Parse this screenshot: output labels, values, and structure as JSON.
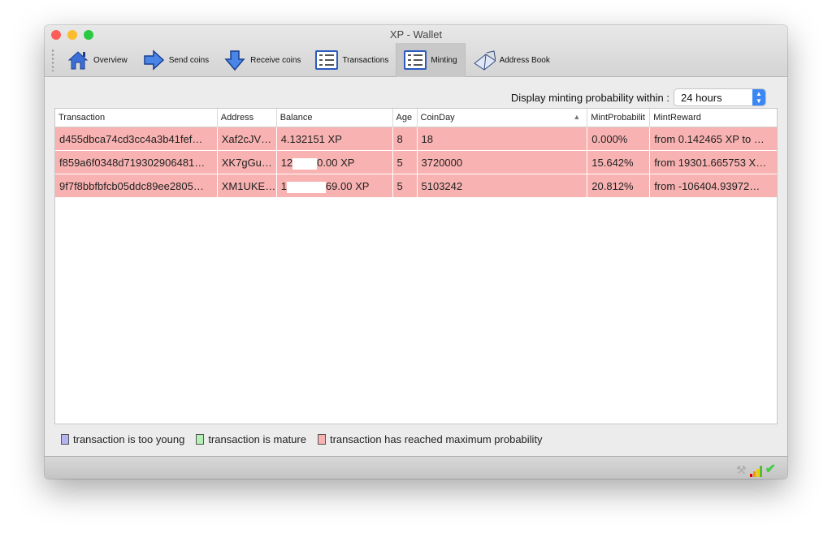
{
  "window": {
    "title": "XP - Wallet"
  },
  "toolbar": {
    "items": [
      {
        "label": "Overview",
        "icon": "home-icon"
      },
      {
        "label": "Send coins",
        "icon": "arrow-right-icon"
      },
      {
        "label": "Receive coins",
        "icon": "arrow-down-icon"
      },
      {
        "label": "Transactions",
        "icon": "list-icon"
      },
      {
        "label": "Minting",
        "icon": "list-icon",
        "active": true
      },
      {
        "label": "Address Book",
        "icon": "book-icon"
      }
    ]
  },
  "minting": {
    "prob_label": "Display minting probability within :",
    "prob_value": "24 hours"
  },
  "table": {
    "headers": [
      "Transaction",
      "Address",
      "Balance",
      "Age",
      "CoinDay",
      "MintProbabilit",
      "MintReward"
    ],
    "sort": {
      "column": "CoinDay",
      "direction": "ascending"
    },
    "rows": [
      {
        "tx": "d455dbca74cd3cc4a3b41fef…",
        "address": "Xaf2cJV…",
        "bal_a": "4.132151 XP",
        "bal_b": "",
        "age": "8",
        "coinday": "18",
        "prob": "0.000%",
        "reward": "from  0.142465 XP to …"
      },
      {
        "tx": "f859a6f0348d719302906481…",
        "address": "XK7gGu…",
        "bal_a": "12",
        "bal_b": "0.00 XP",
        "age": "5",
        "coinday": "3720000",
        "prob": "15.642%",
        "reward": "from  19301.665753 X…"
      },
      {
        "tx": "9f7f8bbfbfcb05ddc89ee2805…",
        "address": "XM1UKE…",
        "bal_a": "1",
        "bal_b": "69.00 XP",
        "age": "5",
        "coinday": "5103242",
        "prob": "20.812%",
        "reward": "from  -106404.93972…"
      }
    ]
  },
  "legend": [
    {
      "label": "transaction is too young",
      "color": "#b4b4f0"
    },
    {
      "label": "transaction is mature",
      "color": "#b4f0b4"
    },
    {
      "label": "transaction has reached maximum probability",
      "color": "#f9b2b2"
    }
  ],
  "colors": {
    "row_max_prob": "#f9b2b2",
    "accent": "#3b88f5"
  }
}
